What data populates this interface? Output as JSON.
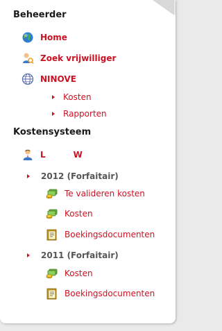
{
  "panel": {
    "sections": [
      {
        "title": "Beheerder"
      },
      {
        "title": "Kostensysteem"
      }
    ]
  },
  "beheerder": {
    "home": "Home",
    "zoek": "Zoek vrijwilliger",
    "ninove": "NINOVE",
    "kosten": "Kosten",
    "rapporten": "Rapporten"
  },
  "kostensysteem": {
    "user_first": "L",
    "user_last": "W",
    "groups": [
      {
        "label": "2012 (Forfaitair)",
        "items": [
          "Te valideren kosten",
          "Kosten",
          "Boekingsdocumenten"
        ]
      },
      {
        "label": "2011 (Forfaitair)",
        "items": [
          "Kosten",
          "Boekingsdocumenten"
        ]
      }
    ]
  },
  "colors": {
    "link": "#cc1122",
    "heading": "#1a1a1a",
    "group": "#555555"
  },
  "icons": {
    "home": "globe-icon",
    "zoek": "user-search-icon",
    "ninove": "network-globe-icon",
    "submenu": "arrow-right-icon",
    "user": "user-icon",
    "money": "money-coins-icon",
    "document": "booking-document-icon"
  }
}
